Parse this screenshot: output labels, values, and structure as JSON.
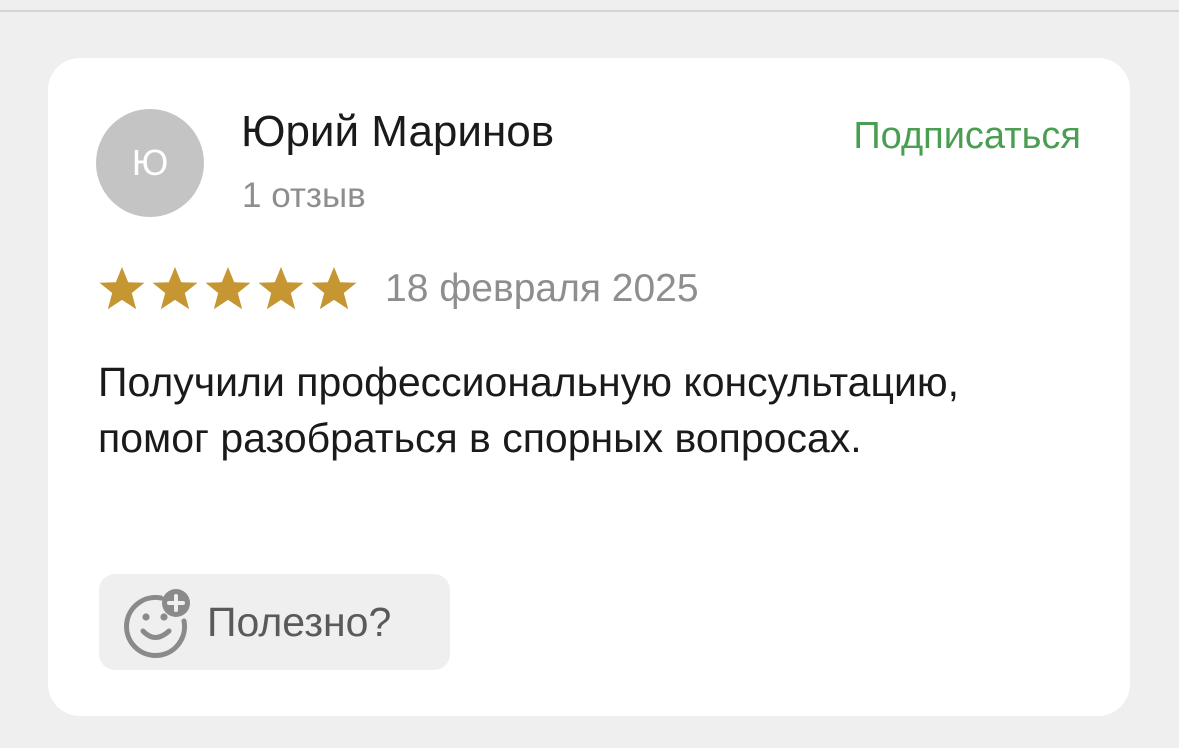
{
  "review": {
    "author": {
      "initial": "Ю",
      "name": "Юрий Маринов",
      "review_count": "1 отзыв"
    },
    "subscribe_label": "Подписаться",
    "rating": 5,
    "rating_max": 5,
    "date": "18 февраля 2025",
    "text": "Получили профессиональную консультацию, помог разобраться в спорных вопросах.",
    "helpful_label": "Полезно?"
  },
  "colors": {
    "accent_green": "#4a9e52",
    "star_gold": "#c59632",
    "avatar_bg": "#c4c4c4",
    "muted_text": "#8e8e8e",
    "page_bg": "#efefef"
  },
  "icons": {
    "star": "star-icon",
    "helpful": "smile-plus-icon"
  }
}
